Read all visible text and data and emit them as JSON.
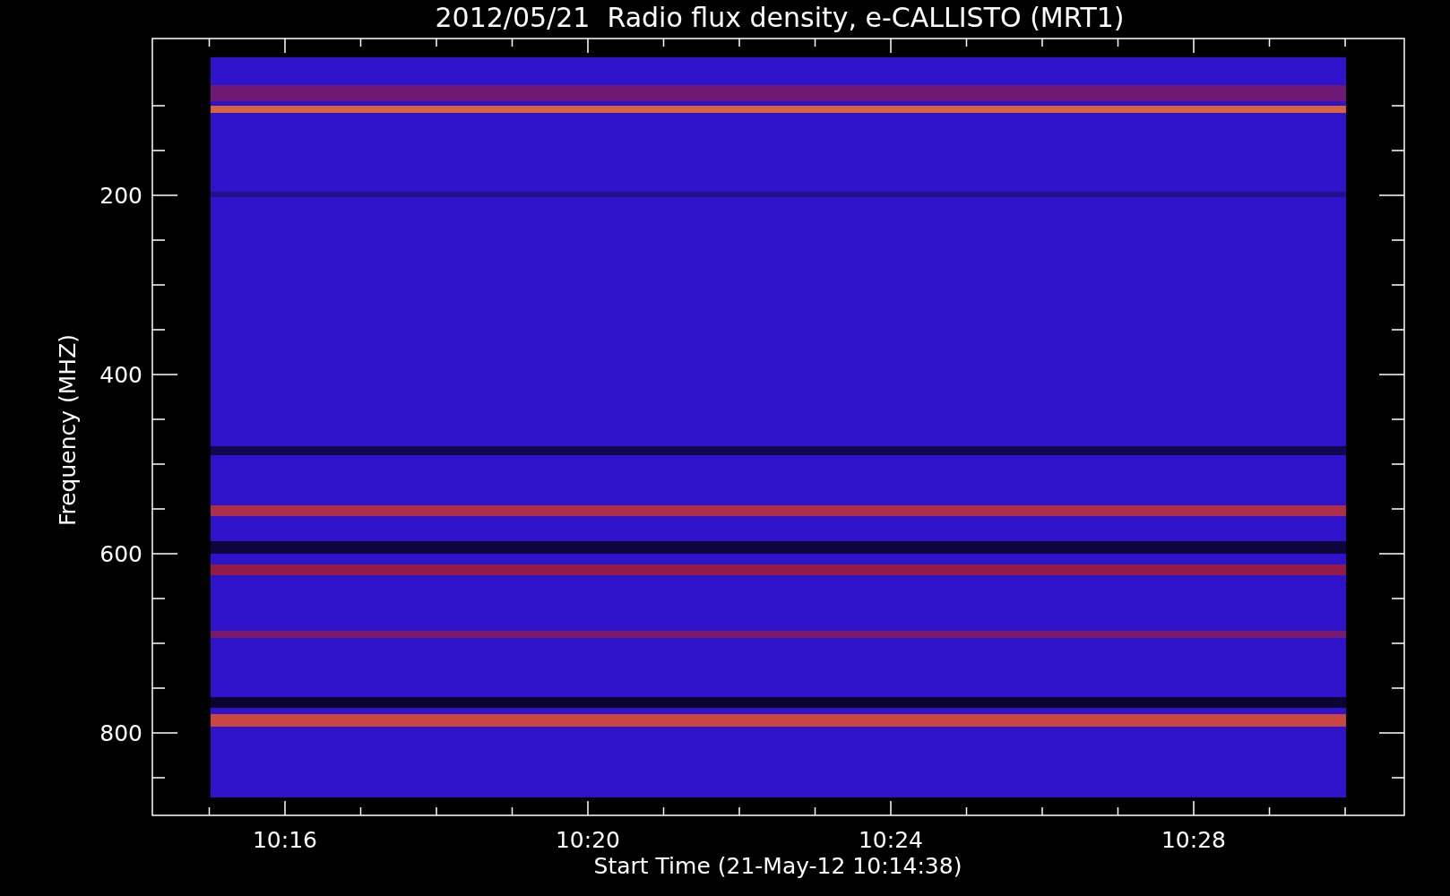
{
  "title": "2012/05/21  Radio flux density, e-CALLISTO (MRT1)",
  "y_axis": {
    "label": "Frequency (MHZ)",
    "ticks": [
      "200",
      "400",
      "600",
      "800"
    ]
  },
  "x_axis": {
    "label": "Start Time (21-May-12 10:14:38)",
    "ticks": [
      "10:16",
      "10:20",
      "10:24",
      "10:28"
    ]
  }
}
